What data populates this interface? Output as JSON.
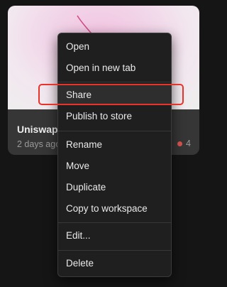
{
  "card": {
    "title": "Uniswap",
    "meta": "2 days ago",
    "count": "4",
    "status_color": "#d9534f"
  },
  "menu": {
    "items": [
      {
        "label": "Open"
      },
      {
        "label": "Open in new tab"
      },
      {
        "label": "Share",
        "highlighted": true
      },
      {
        "label": "Publish to store"
      },
      {
        "label": "Rename"
      },
      {
        "label": "Move"
      },
      {
        "label": "Duplicate"
      },
      {
        "label": "Copy to workspace"
      },
      {
        "label": "Edit..."
      },
      {
        "label": "Delete"
      }
    ]
  },
  "colors": {
    "highlight_ring": "#e8332b",
    "menu_background": "#1f1f1f"
  }
}
